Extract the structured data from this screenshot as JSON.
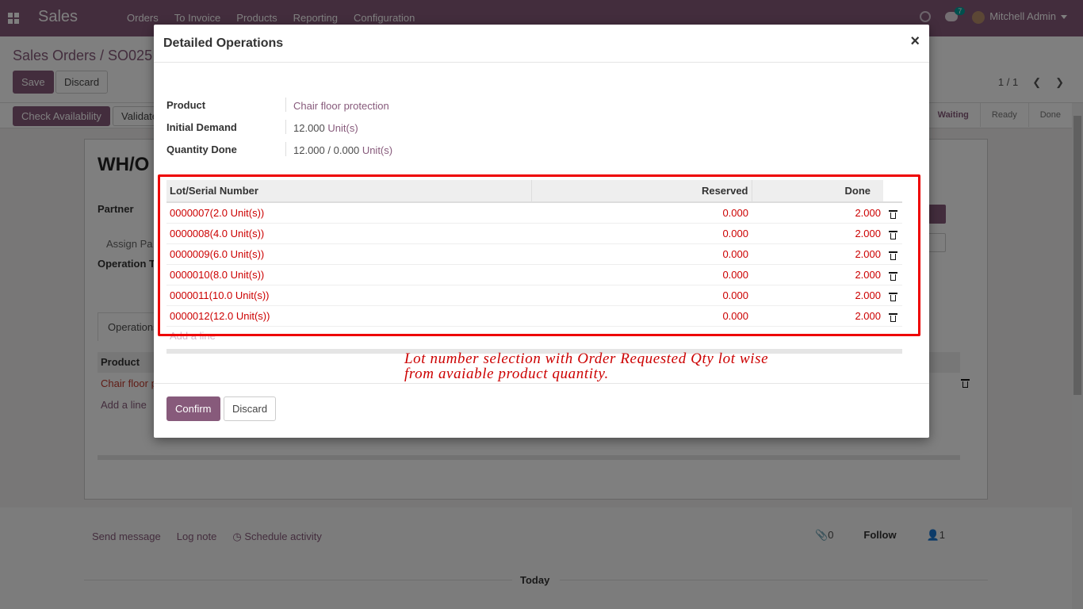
{
  "navbar": {
    "brand": "Sales",
    "menu": [
      "Orders",
      "To Invoice",
      "Products",
      "Reporting",
      "Configuration"
    ],
    "chat_count": "7",
    "user": "Mitchell Admin"
  },
  "control_panel": {
    "breadcrumb": "Sales Orders / SO025",
    "save": "Save",
    "discard": "Discard",
    "pager": "1 / 1"
  },
  "statusbar": {
    "check_availability": "Check Availability",
    "validate": "Validate",
    "stages": [
      "Waiting",
      "Ready",
      "Done"
    ],
    "active_stage": "Waiting"
  },
  "sheet": {
    "name": "WH/O",
    "partner_label": "Partner",
    "assign_label": "Assign Pa",
    "operation_label": "Operation T",
    "tab_operations": "Operations",
    "col_product": "Product",
    "row_product": "Chair floor p",
    "add_line": "Add a line"
  },
  "chatter": {
    "send_message": "Send message",
    "log_note": "Log note",
    "schedule_activity": "Schedule activity",
    "attachments": "0",
    "follow": "Follow",
    "followers": "1",
    "today": "Today"
  },
  "modal": {
    "title": "Detailed Operations",
    "product_label": "Product",
    "product_value": "Chair floor protection",
    "demand_label": "Initial Demand",
    "demand_value": "12.000",
    "demand_uom": "Unit(s)",
    "qty_done_label": "Quantity Done",
    "qty_done_value": "12.000",
    "qty_done_sep": "/",
    "qty_done_reserved": "0.000",
    "qty_done_uom": "Unit(s)",
    "columns": [
      "Lot/Serial Number",
      "Reserved",
      "Done"
    ],
    "rows": [
      {
        "lot": "0000007(2.0 Unit(s))",
        "reserved": "0.000",
        "done": "2.000"
      },
      {
        "lot": "0000008(4.0 Unit(s))",
        "reserved": "0.000",
        "done": "2.000"
      },
      {
        "lot": "0000009(6.0 Unit(s))",
        "reserved": "0.000",
        "done": "2.000"
      },
      {
        "lot": "0000010(8.0 Unit(s))",
        "reserved": "0.000",
        "done": "2.000"
      },
      {
        "lot": "0000011(10.0 Unit(s))",
        "reserved": "0.000",
        "done": "2.000"
      },
      {
        "lot": "0000012(12.0 Unit(s))",
        "reserved": "0.000",
        "done": "2.000"
      }
    ],
    "add_line": "Add a line",
    "annotation_line1": "Lot number selection with Order Requested Qty lot wise",
    "annotation_line2": "from avaiable product quantity.",
    "confirm": "Confirm",
    "discard": "Discard"
  },
  "colors": {
    "brand": "#875a7b",
    "annotation": "#e00000",
    "lot_text": "#cc0000"
  }
}
